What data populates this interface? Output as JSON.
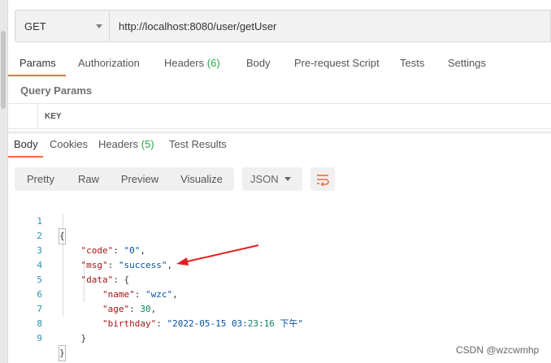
{
  "request": {
    "method": "GET",
    "url": "http://localhost:8080/user/getUser"
  },
  "request_tabs": [
    {
      "label": "Params",
      "count": ""
    },
    {
      "label": "Authorization",
      "count": ""
    },
    {
      "label": "Headers",
      "count": "(6)"
    },
    {
      "label": "Body",
      "count": ""
    },
    {
      "label": "Pre-request Script",
      "count": ""
    },
    {
      "label": "Tests",
      "count": ""
    },
    {
      "label": "Settings",
      "count": ""
    }
  ],
  "query_params": {
    "title": "Query Params",
    "key_header": "KEY"
  },
  "response_tabs": [
    {
      "label": "Body",
      "count": ""
    },
    {
      "label": "Cookies",
      "count": ""
    },
    {
      "label": "Headers",
      "count": "(5)"
    },
    {
      "label": "Test Results",
      "count": ""
    }
  ],
  "view_modes": [
    "Pretty",
    "Raw",
    "Preview",
    "Visualize"
  ],
  "format": "JSON",
  "icons": {
    "method_dropdown": "chevron-down-icon",
    "format_dropdown": "chevron-down-icon",
    "wrap": "wrap-lines-icon",
    "annotation": "red-arrow-annotation"
  },
  "code_lines": [
    {
      "n": "1",
      "text": "{"
    },
    {
      "n": "2",
      "text": "    \"code\": \"0\","
    },
    {
      "n": "3",
      "text": "    \"msg\": \"success\","
    },
    {
      "n": "4",
      "text": "    \"data\": {"
    },
    {
      "n": "5",
      "text": "        \"name\": \"wzc\","
    },
    {
      "n": "6",
      "text": "        \"age\": 30,"
    },
    {
      "n": "7",
      "text": "        \"birthday\": \"2022-05-15 03:23:16 下午\""
    },
    {
      "n": "8",
      "text": "    }"
    },
    {
      "n": "9",
      "text": "}"
    }
  ],
  "colors": {
    "accent": "#f26b3a",
    "count_green": "#26a74a",
    "json_key": "#a31515",
    "json_string": "#0451a5",
    "json_number": "#098658",
    "arrow_red": "#e02020"
  },
  "watermark": "CSDN @wzcwmhp"
}
